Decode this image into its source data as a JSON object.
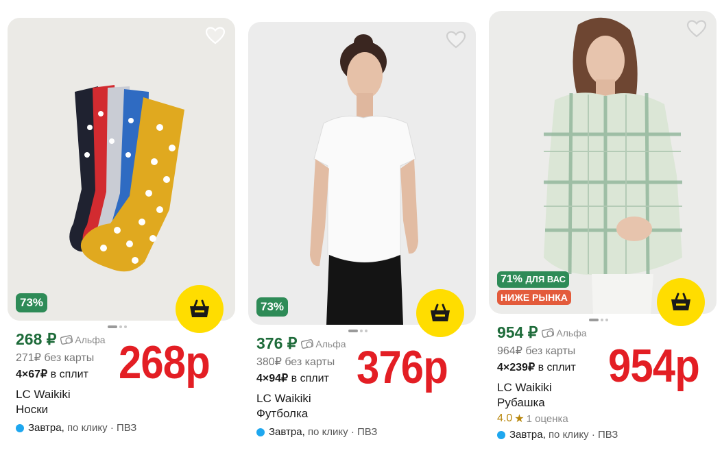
{
  "products": [
    {
      "discount_badge": "73%",
      "price": "268 ₽",
      "alfa_label": "Альфа",
      "old_price": "271₽ без карты",
      "split_prefix": "4×67₽",
      "split_suffix": "в сплит",
      "brand": "LC Waikiki",
      "name": "Носки",
      "delivery_bold": "Завтра,",
      "delivery_rest": "по клику · ПВЗ",
      "overlay_price": "268р",
      "favorite_icon": "heart-icon",
      "cart_icon": "basket-icon"
    },
    {
      "discount_badge": "73%",
      "price": "376 ₽",
      "alfa_label": "Альфа",
      "old_price": "380₽ без карты",
      "split_prefix": "4×94₽",
      "split_suffix": "в сплит",
      "brand": "LC Waikiki",
      "name": "Футболка",
      "delivery_bold": "Завтра,",
      "delivery_rest": "по клику · ПВЗ",
      "overlay_price": "376р",
      "favorite_icon": "heart-icon",
      "cart_icon": "basket-icon"
    },
    {
      "badge_main": "71%",
      "badge_suffix": "ДЛЯ ВАС",
      "badge_red": "НИЖЕ РЫНКА",
      "price": "954 ₽",
      "alfa_label": "Альфа",
      "old_price": "964₽ без карты",
      "split_prefix": "4×239₽",
      "split_suffix": "в сплит",
      "brand": "LC Waikiki",
      "name": "Рубашка",
      "rating_value": "4.0",
      "rating_star": "★",
      "rating_count": "1 оценка",
      "delivery_bold": "Завтра,",
      "delivery_rest": "по клику · ПВЗ",
      "overlay_price": "954р",
      "favorite_icon": "heart-icon",
      "cart_icon": "basket-icon"
    }
  ],
  "colors": {
    "price_green": "#1e6b3a",
    "badge_green": "#2e8b57",
    "badge_red": "#e35b3b",
    "overlay_red": "#e31e24",
    "cart_yellow": "#ffdd00",
    "delivery_blue": "#1ea7ef"
  }
}
